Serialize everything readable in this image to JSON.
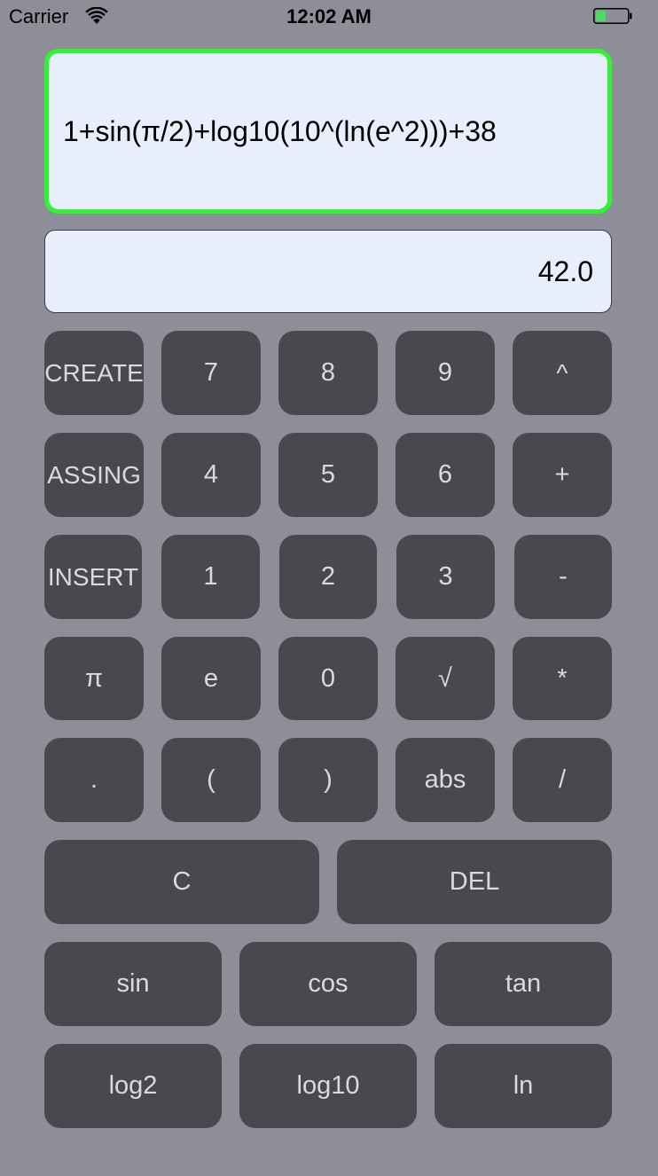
{
  "status_bar": {
    "carrier": "Carrier",
    "time": "12:02 AM",
    "wifi_icon": "wifi-icon",
    "battery_icon": "battery-icon",
    "battery_level": 0.3,
    "battery_color": "#4cd964"
  },
  "display": {
    "expression": "1+sin(π/2)+log10(10^(ln(e^2)))+38",
    "result": "42.0",
    "expression_border_color": "#2ef52e"
  },
  "keys": {
    "row1": [
      "CREATE",
      "7",
      "8",
      "9",
      "^"
    ],
    "row2": [
      "ASSING",
      "4",
      "5",
      "6",
      "+"
    ],
    "row3": [
      "INSERT",
      "1",
      "2",
      "3",
      "-"
    ],
    "row4": [
      "π",
      "e",
      "0",
      "√",
      "*"
    ],
    "row5": [
      ".",
      "(",
      ")",
      "abs",
      "/"
    ],
    "row6": [
      "C",
      "DEL"
    ],
    "row7": [
      "sin",
      "cos",
      "tan"
    ],
    "row8": [
      "log2",
      "log10",
      "ln"
    ]
  },
  "colors": {
    "background": "#8e8e98",
    "key_background": "#48484e",
    "key_text": "#d9d9de",
    "field_background": "#e8eefc"
  }
}
